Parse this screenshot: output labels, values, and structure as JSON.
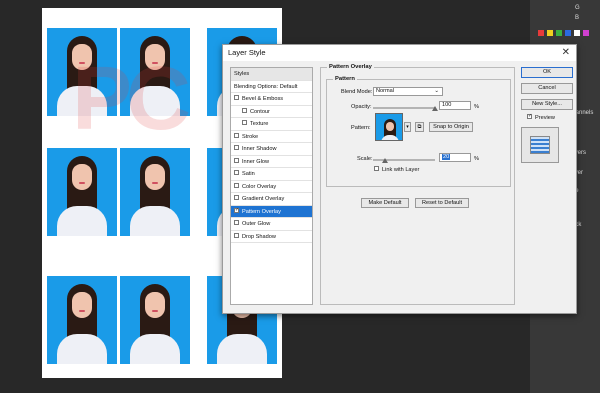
{
  "background_photo": {
    "watermark": "PC",
    "rows": 3,
    "cols": 3
  },
  "right_panel": {
    "items": [
      "G",
      "B",
      "Layer",
      "Effe",
      "Back",
      "Channels",
      "Layers"
    ],
    "swatches": [
      "#e83a3a",
      "#f0d020",
      "#3ab040",
      "#2a6ae0",
      "#ffffff",
      "#d040d0"
    ]
  },
  "dialog": {
    "title": "Layer Style",
    "styles": {
      "header_styles": "Styles",
      "header_blending": "Blending Options: Default",
      "items": [
        {
          "label": "Bevel & Emboss",
          "checked": false,
          "sub": false
        },
        {
          "label": "Contour",
          "checked": false,
          "sub": true
        },
        {
          "label": "Texture",
          "checked": false,
          "sub": true
        },
        {
          "label": "Stroke",
          "checked": false,
          "sub": false
        },
        {
          "label": "Inner Shadow",
          "checked": false,
          "sub": false
        },
        {
          "label": "Inner Glow",
          "checked": false,
          "sub": false
        },
        {
          "label": "Satin",
          "checked": false,
          "sub": false
        },
        {
          "label": "Color Overlay",
          "checked": false,
          "sub": false
        },
        {
          "label": "Gradient Overlay",
          "checked": false,
          "sub": false
        },
        {
          "label": "Pattern Overlay",
          "checked": true,
          "sub": false,
          "selected": true
        },
        {
          "label": "Outer Glow",
          "checked": false,
          "sub": false
        },
        {
          "label": "Drop Shadow",
          "checked": false,
          "sub": false
        }
      ]
    },
    "pattern_overlay": {
      "group_title": "Pattern Overlay",
      "subgroup_title": "Pattern",
      "blend_mode_label": "Blend Mode:",
      "blend_mode_value": "Normal",
      "opacity_label": "Opacity:",
      "opacity_value": "100",
      "opacity_unit": "%",
      "opacity_fraction": 1.0,
      "pattern_label": "Pattern:",
      "snap_button": "Snap to Origin",
      "scale_label": "Scale:",
      "scale_value": "20",
      "scale_unit": "%",
      "scale_fraction": 0.2,
      "link_label": "Link with Layer",
      "link_checked": false,
      "make_default": "Make Default",
      "reset_default": "Reset to Default"
    },
    "buttons": {
      "ok": "OK",
      "cancel": "Cancel",
      "new_style": "New Style...",
      "preview_label": "Preview",
      "preview_checked": true
    }
  }
}
